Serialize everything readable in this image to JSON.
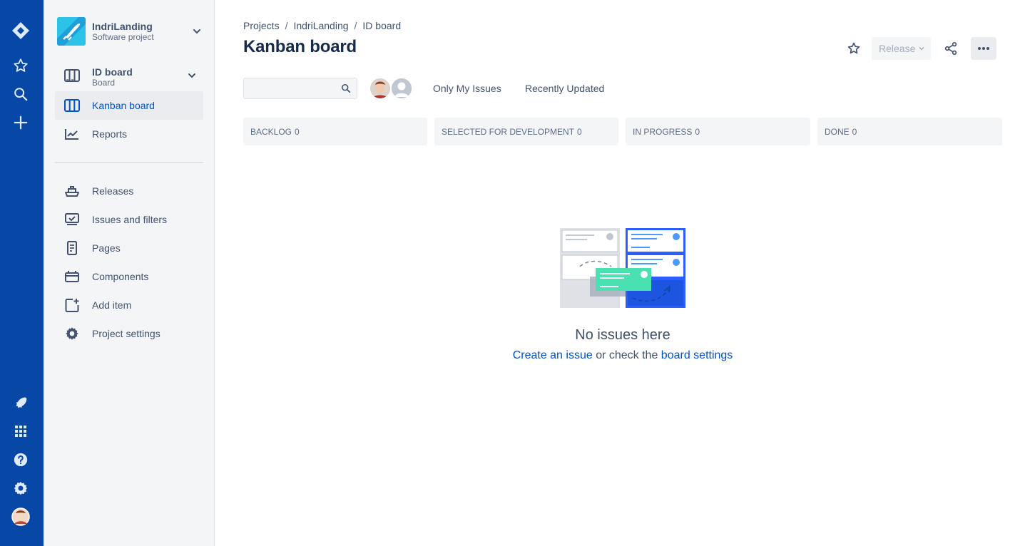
{
  "global_nav": {
    "top_icons": [
      "jira-logo-icon",
      "star-icon",
      "search-icon",
      "plus-icon"
    ],
    "bottom_icons": [
      "rocket-icon",
      "app-switcher-icon",
      "help-icon",
      "settings-icon",
      "user-avatar"
    ],
    "background": "#0747a6"
  },
  "project": {
    "name": "IndriLanding",
    "type": "Software project"
  },
  "board_selector": {
    "name": "ID board",
    "type": "Board"
  },
  "sidebar": {
    "items": [
      {
        "label": "Kanban board",
        "icon": "board-columns-icon",
        "active": true
      },
      {
        "label": "Reports",
        "icon": "line-chart-icon",
        "active": false
      },
      {
        "label": "Releases",
        "icon": "ship-icon",
        "active": false
      },
      {
        "label": "Issues and filters",
        "icon": "issues-icon",
        "active": false
      },
      {
        "label": "Pages",
        "icon": "page-icon",
        "active": false
      },
      {
        "label": "Components",
        "icon": "component-icon",
        "active": false
      },
      {
        "label": "Add item",
        "icon": "add-item-icon",
        "active": false
      },
      {
        "label": "Project settings",
        "icon": "gear-icon",
        "active": false
      }
    ]
  },
  "breadcrumbs": [
    "Projects",
    "IndriLanding",
    "ID board"
  ],
  "page_title": "Kanban board",
  "toolbar": {
    "release_label": "Release"
  },
  "search": {
    "value": "",
    "placeholder": ""
  },
  "quick_filters": [
    "Only My Issues",
    "Recently Updated"
  ],
  "columns": [
    {
      "name": "BACKLOG",
      "count": "0"
    },
    {
      "name": "SELECTED FOR DEVELOPMENT",
      "count": "0"
    },
    {
      "name": "IN PROGRESS",
      "count": "0"
    },
    {
      "name": "DONE",
      "count": "0"
    }
  ],
  "empty_state": {
    "title": "No issues here",
    "link1": "Create an issue",
    "middle": " or check the ",
    "link2": "board settings"
  },
  "colors": {
    "accent": "#0052cc",
    "text": "#42526e",
    "sidebar_bg": "#f4f5f7"
  }
}
